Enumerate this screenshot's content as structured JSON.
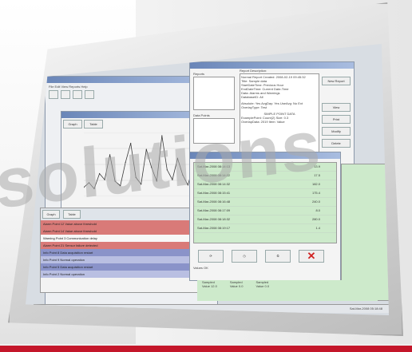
{
  "watermark": "solutions",
  "app": {
    "main_window_title": "",
    "report_window_title": "Reports",
    "data_window_title": "Data"
  },
  "report_panel": {
    "list_label": "Reports",
    "description_label": "Report Description:",
    "description_lines": [
      "Normal Report   Created: 2008-02-19 09:45:32",
      "Title: Sample data",
      "StartDateTime: Previous Hour",
      "EndDateTime: Current Date-Time",
      "Data: Alarms and Warnings",
      "DatabaseID: All"
    ],
    "mid_lines": [
      "Absolute: Yes  AvgDay: Yes  UseAvg: No  Ext",
      "OverlayType: Test"
    ],
    "sample_caption": "SIMPLE POINT DATA",
    "example_lines": [
      "ExamplePoint: Count(2)   Size: 0.3",
      "OverlapData: 2019    Item: Value"
    ],
    "points_label": "Data Points"
  },
  "side_buttons": [
    "New Report",
    "View",
    "Print",
    "Modify",
    "Delete"
  ],
  "data_table": {
    "timestamps": [
      "Sat-Mar-2008 08:14:13",
      "Sat-Mar-2008 08:14:22",
      "Sat-Mar-2008 08:14:32",
      "Sat-Mar-2008 08:15:41",
      "Sat-Mar-2008 08:16:48",
      "Sat-Mar-2008 08:17:09",
      "Sat-Mar-2008 08:18:32",
      "Sat-Mar-2008 08:19:17"
    ],
    "values": [
      "13.9",
      "17.5",
      "182.0",
      "175.4",
      "240.0",
      "8.0",
      "280.0",
      "1.4"
    ],
    "status": "Values OK"
  },
  "left_table": {
    "rows": [
      {
        "style": "red",
        "text": "Alarm   Point 12   Value above threshold"
      },
      {
        "style": "red",
        "text": "Alarm   Point 14   Value above threshold"
      },
      {
        "style": "white",
        "text": "Warning   Point 3   Communication delay"
      },
      {
        "style": "red",
        "text": "Alarm   Point 21   Sensor failure detected"
      },
      {
        "style": "blue",
        "text": "Info   Point 8   Data acquisition restart"
      },
      {
        "style": "lav",
        "text": "Info   Point 9   Normal operation"
      },
      {
        "style": "blue",
        "text": "Info   Point 5   Data acquisition restart"
      },
      {
        "style": "lav",
        "text": "Info   Point 2   Normal operation"
      }
    ]
  },
  "chart": {
    "tabs": [
      "Graph",
      "Table"
    ],
    "values": [
      12,
      18,
      10,
      30,
      22,
      55,
      20,
      14,
      45,
      70,
      25,
      16,
      62,
      38,
      20,
      80,
      35,
      22,
      50,
      28,
      15,
      40,
      24,
      18
    ]
  },
  "bottom": {
    "date": "Sat-Mar-2008 05:18:48",
    "left_status": "Ready",
    "group_labels": [
      "Sampled",
      "Sampled",
      "Sampled"
    ],
    "group_values": [
      "Value   12.0",
      "Value   0.0",
      "Value   0.0"
    ],
    "right_value": "0.0 Temp",
    "nav": [
      "Graph",
      "Table"
    ]
  },
  "colors": {
    "accent_red": "#c4162a",
    "alarm_row": "#d97a78",
    "info_row": "#8a93c9",
    "data_green": "#cdeacb"
  }
}
